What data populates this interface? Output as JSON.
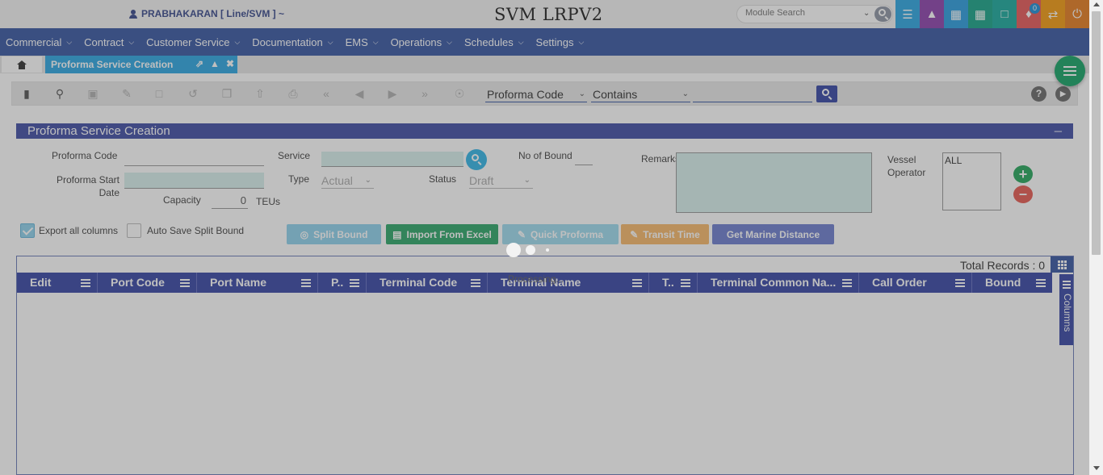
{
  "header": {
    "user": "PRABHAKARAN [ Line/SVM ] ~",
    "app_title": "SVM LRPV2",
    "module_search_placeholder": "Module Search",
    "notification_count": "0",
    "tiles": [
      {
        "icon": "menu-icon",
        "color": "#2fa8e3"
      },
      {
        "icon": "chart-area-icon",
        "color": "#8e44ad"
      },
      {
        "icon": "switch-icon",
        "color": "#2d9fe0"
      },
      {
        "icon": "grid-icon",
        "color": "#1aa58a"
      },
      {
        "icon": "lock-icon",
        "color": "#1cab9e"
      },
      {
        "icon": "bell-icon",
        "color": "#e85a5a"
      },
      {
        "icon": "exchange-icon",
        "color": "#f39c12"
      },
      {
        "icon": "logout-icon",
        "color": "#e67e22"
      }
    ]
  },
  "nav": {
    "items": [
      "Commercial",
      "Contract",
      "Customer Service",
      "Documentation",
      "EMS",
      "Operations",
      "Schedules",
      "Settings"
    ]
  },
  "tabs": {
    "active_label": "Proforma Service Creation"
  },
  "toolbar": {
    "search_field": "Proforma Code",
    "search_operator": "Contains",
    "search_value": "",
    "help_label": "?"
  },
  "form": {
    "panel_title": "Proforma Service Creation",
    "proforma_code_label": "Proforma Code",
    "service_label": "Service",
    "no_of_bound_label": "No of Bound",
    "remarks_label": "Remarks",
    "vessel_operator_label": "Vessel Operator",
    "vessel_operator_value": "ALL",
    "proforma_start_date_label": "Proforma Start Date",
    "type_label": "Type",
    "type_value": "Actual",
    "status_label": "Status",
    "status_value": "Draft",
    "capacity_label": "Capacity",
    "capacity_value": "0",
    "capacity_unit": "TEUs",
    "export_all_columns_label": "Export all columns",
    "auto_save_split_bound_label": "Auto Save Split Bound",
    "export_all_columns_checked": true,
    "auto_save_split_bound_checked": false
  },
  "actions": {
    "split_bound": "Split Bound",
    "import_from_excel": "Import From Excel",
    "quick_proforma": "Quick Proforma",
    "transit_time": "Transit Time",
    "get_marine_distance": "Get Marine Distance"
  },
  "grid": {
    "total_records_label": "Total Records : 0",
    "columns": [
      "Edit",
      "Port Code",
      "Port Name",
      "P..",
      "Terminal Code",
      "Terminal Name",
      "T..",
      "Terminal Common Na...",
      "Call Order",
      "Bound"
    ],
    "side_panel_label": "Columns"
  },
  "overlay": {
    "processing_label": "Processing..."
  }
}
